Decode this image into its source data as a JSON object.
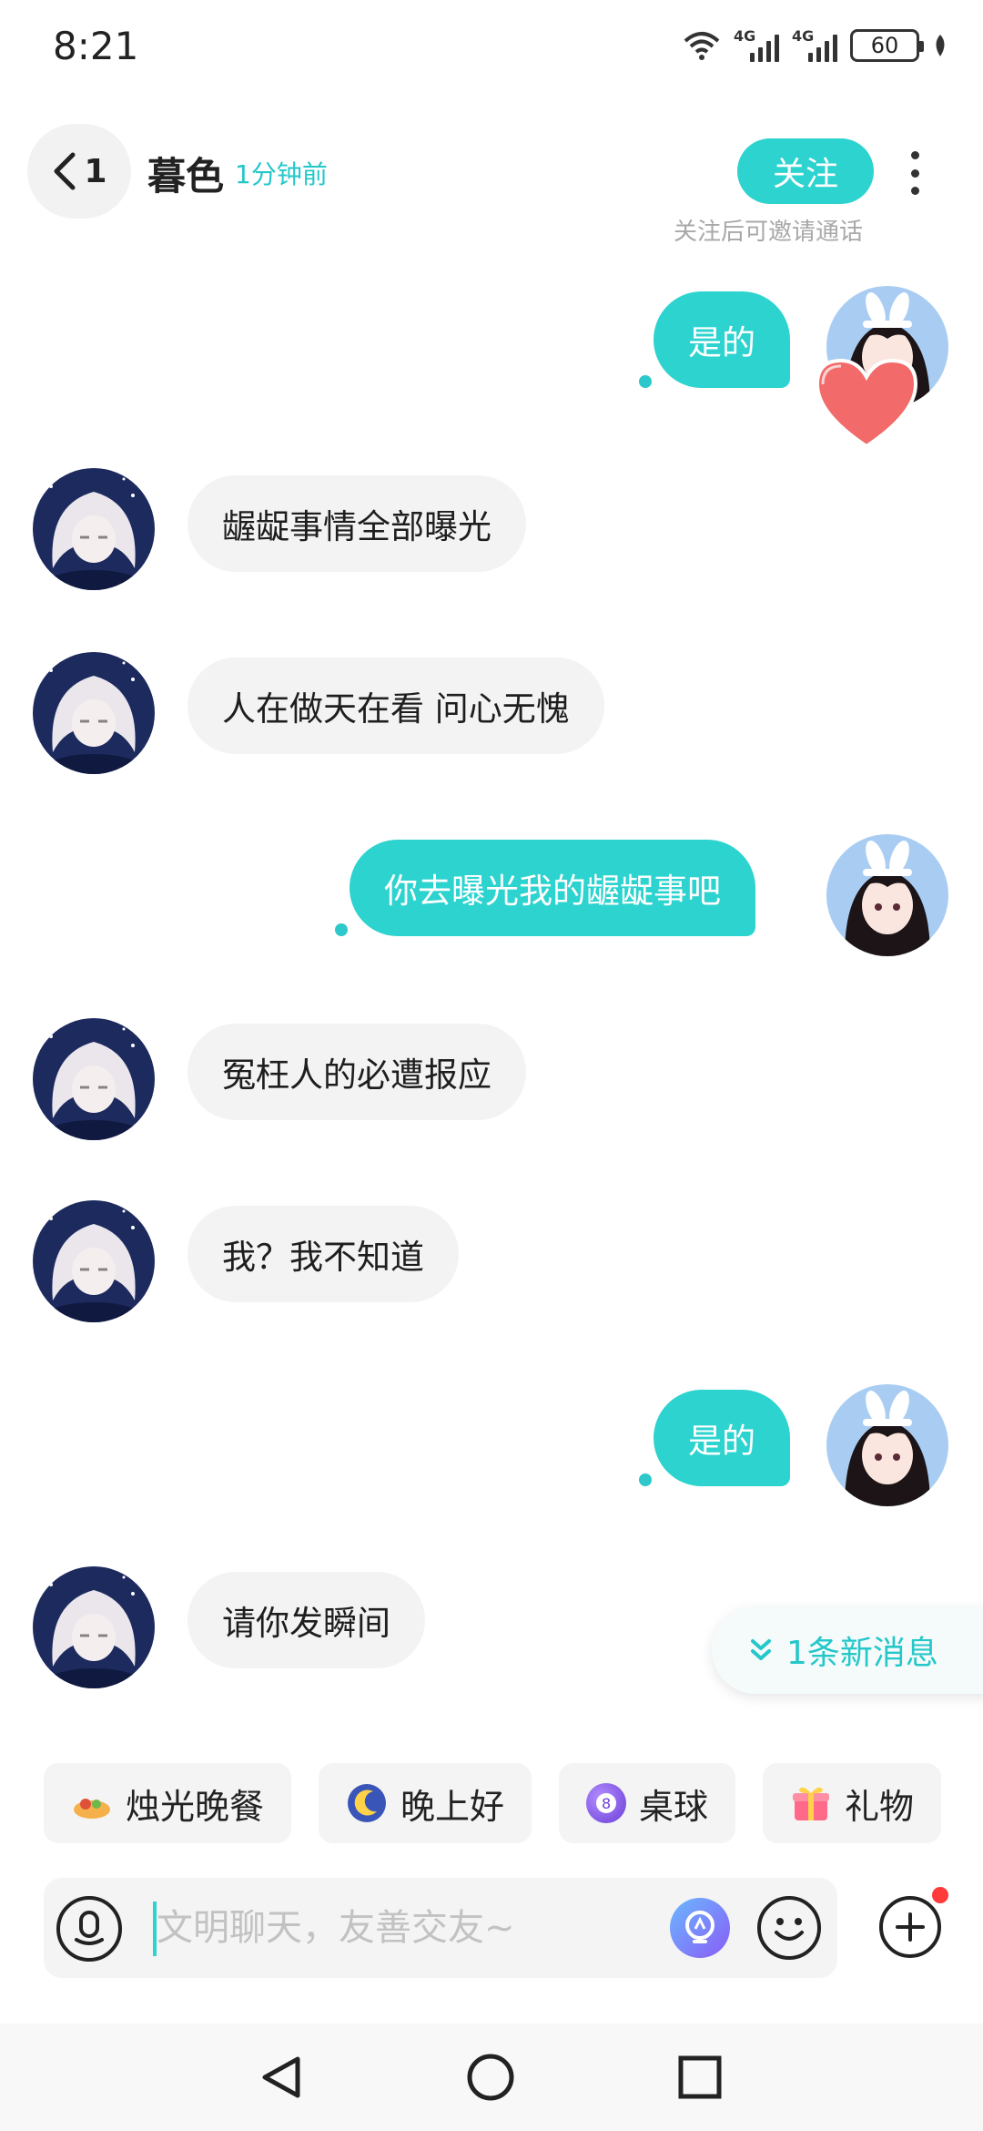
{
  "status_bar": {
    "time": "8:21",
    "network_1": "4G",
    "network_2": "4G",
    "battery": "60"
  },
  "header": {
    "back_count": "1",
    "contact_name": "暮色",
    "last_seen": "1分钟前",
    "follow_label": "关注",
    "follow_hint": "关注后可邀请通话"
  },
  "messages": [
    {
      "side": "out",
      "text": "是的"
    },
    {
      "side": "in",
      "text": "龌龊事情全部曝光"
    },
    {
      "side": "in",
      "text": "人在做天在看  问心无愧"
    },
    {
      "side": "out",
      "text": "你去曝光我的龌龊事吧"
    },
    {
      "side": "in",
      "text": "冤枉人的必遭报应"
    },
    {
      "side": "in",
      "text": "我？我不知道"
    },
    {
      "side": "out",
      "text": "是的"
    },
    {
      "side": "in",
      "text": "请你发瞬间"
    }
  ],
  "new_message_toast": "1条新消息",
  "quick_actions": [
    {
      "label": "烛光晚餐",
      "icon": "candlelight-dinner-icon"
    },
    {
      "label": "晚上好",
      "icon": "moon-icon"
    },
    {
      "label": "桌球",
      "icon": "billiard-ball-icon",
      "badge": "8"
    },
    {
      "label": "礼物",
      "icon": "gift-icon"
    }
  ],
  "input": {
    "placeholder": "文明聊天，友善交友~"
  },
  "colors": {
    "accent": "#2dd3cf",
    "incoming_bubble": "#f3f3f3",
    "notification_dot": "#ff3b3b"
  }
}
